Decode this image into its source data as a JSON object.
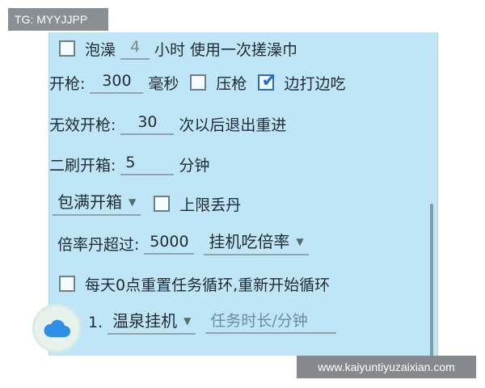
{
  "tag": "TG: MYYJJPP",
  "watermark": "www.kaiyuntiyuzaixian.com",
  "rows": {
    "bath": {
      "label": "泡澡",
      "value": "4",
      "suffix": "小时 使用一次搓澡巾",
      "checked": false
    },
    "fire": {
      "label": "开枪:",
      "value": "300",
      "unit": "毫秒",
      "press_label": "压枪",
      "press_checked": false,
      "hit_eat_label": "边打边吃",
      "hit_eat_checked": true
    },
    "invalid": {
      "label": "无效开枪:",
      "value": "30",
      "suffix": "次以后退出重进"
    },
    "second": {
      "label": "二刷开箱:",
      "value": "5",
      "suffix": "分钟"
    },
    "full": {
      "select": "包满开箱",
      "limit_label": "上限丢丹",
      "limit_checked": false
    },
    "rate": {
      "label": "倍率丹超过:",
      "value": "5000",
      "select": "挂机吃倍率"
    },
    "daily": {
      "label": "每天0点重置任务循环,重新开始循环",
      "checked": false
    },
    "task1": {
      "index": "1.",
      "select": "温泉挂机",
      "placeholder": "任务时长/分钟"
    }
  },
  "colors": {
    "panel": "#bfe6f6",
    "check_accent": "#1f6fd1",
    "cloud": "#2f8fe6"
  },
  "icons": {
    "float": "cloud-icon",
    "dropdown": "chevron-down-icon",
    "check": "check-icon"
  }
}
